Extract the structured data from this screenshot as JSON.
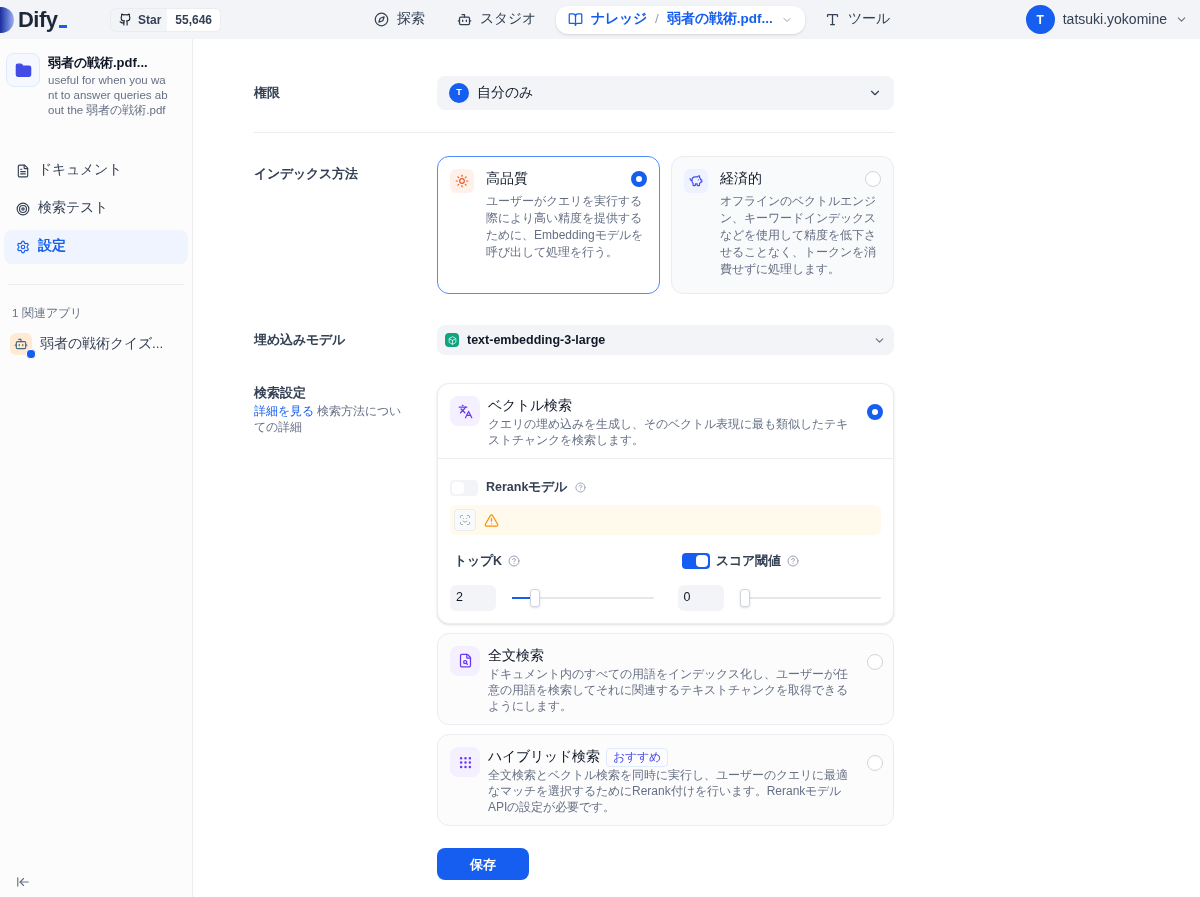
{
  "header": {
    "logo": "Dify",
    "github": {
      "label": "Star",
      "count": "55,646"
    },
    "nav": [
      {
        "kind": "link",
        "label": "探索",
        "selected": false
      },
      {
        "kind": "link",
        "label": "スタジオ",
        "selected": false
      },
      {
        "kind": "breadcrumb",
        "label": "ナレッジ",
        "separator": "/",
        "sub": "弱者の戦術.pdf...",
        "selected": true
      },
      {
        "kind": "link",
        "label": "ツール",
        "selected": false
      }
    ],
    "user": {
      "initial": "T",
      "name": "tatsuki.yokomine"
    }
  },
  "sidebar": {
    "dataset": {
      "name": "弱者の戦術.pdf...",
      "description": "useful for when you want to answer queries about the 弱者の戦術.pdf"
    },
    "items": [
      {
        "label": "ドキュメント",
        "selected": false
      },
      {
        "label": "検索テスト",
        "selected": false
      },
      {
        "label": "設定",
        "selected": true
      }
    ],
    "related_title": "1 関連アプリ",
    "apps": [
      {
        "name": "弱者の戦術クイズ..."
      }
    ]
  },
  "form": {
    "permission": {
      "label": "権限",
      "initial": "T",
      "value": "自分のみ"
    },
    "index_method": {
      "label": "インデックス方法",
      "options": [
        {
          "title": "高品質",
          "description": "ユーザーがクエリを実行する際により高い精度を提供するために、Embeddingモデルを呼び出して処理を行う。",
          "selected": true
        },
        {
          "title": "経済的",
          "description": "オフラインのベクトルエンジン、キーワードインデックスなどを使用して精度を低下させることなく、トークンを消費せずに処理します。",
          "selected": false
        }
      ]
    },
    "embedding_model": {
      "label": "埋め込みモデル",
      "value": "text-embedding-3-large"
    },
    "retrieval": {
      "label": "検索設定",
      "link": "詳細を見る",
      "note": "検索方法についての詳細",
      "methods": [
        {
          "title": "ベクトル検索",
          "description": "クエリの埋め込みを生成し、そのベクトル表現に最も類似したテキストチャンクを検索します。",
          "selected": true,
          "rerank": {
            "label": "Rerankモデル",
            "on": false
          },
          "top_k": {
            "label": "トップK",
            "value": "2",
            "level": 0.14
          },
          "score_threshold": {
            "label": "スコア閾値",
            "on": true,
            "value": "0",
            "level": 0
          }
        },
        {
          "title": "全文検索",
          "description": "ドキュメント内のすべての用語をインデックス化し、ユーザーが任意の用語を検索してそれに関連するテキストチャンクを取得できるようにします。",
          "selected": false
        },
        {
          "title": "ハイブリッド検索",
          "badge": "おすすめ",
          "description": "全文検索とベクトル検索を同時に実行し、ユーザーのクエリに最適なマッチを選択するためにRerank付けを行います。RerankモデルAPIの設定が必要です。",
          "selected": false
        }
      ]
    },
    "save": "保存"
  }
}
